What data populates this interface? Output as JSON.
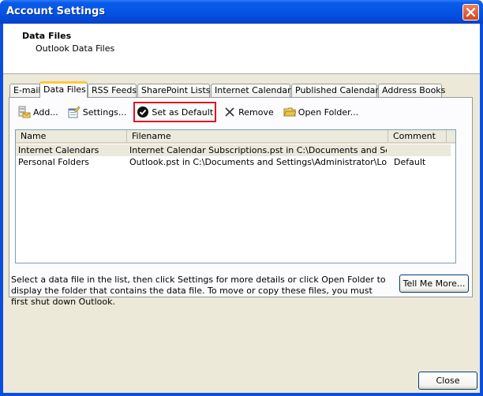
{
  "window": {
    "title": "Account Settings",
    "close_icon": "close-x-icon"
  },
  "header": {
    "title": "Data Files",
    "subtitle": "Outlook Data Files"
  },
  "tabs": [
    {
      "label": "E-mail",
      "active": false
    },
    {
      "label": "Data Files",
      "active": true
    },
    {
      "label": "RSS Feeds",
      "active": false
    },
    {
      "label": "SharePoint Lists",
      "active": false
    },
    {
      "label": "Internet Calendars",
      "active": false
    },
    {
      "label": "Published Calendars",
      "active": false
    },
    {
      "label": "Address Books",
      "active": false
    }
  ],
  "toolbar": {
    "add": {
      "label": "Add...",
      "icon": "add-data-file-icon"
    },
    "settings": {
      "label": "Settings...",
      "icon": "settings-icon"
    },
    "set_default": {
      "label": "Set as Default",
      "icon": "checkmark-circle-icon",
      "highlight_color": "#e0141e"
    },
    "remove": {
      "label": "Remove",
      "icon": "x-icon"
    },
    "open_folder": {
      "label": "Open Folder...",
      "icon": "folder-icon"
    }
  },
  "list": {
    "columns": [
      "Name",
      "Filename",
      "Comment"
    ],
    "rows": [
      {
        "name": "Internet Calendars",
        "filename": "Internet Calendar Subscriptions.pst in C:\\Documents and Settin...",
        "comment": "",
        "selected": true
      },
      {
        "name": "Personal Folders",
        "filename": "Outlook.pst in C:\\Documents and Settings\\Administrator\\Local S...",
        "comment": "Default",
        "selected": false
      }
    ]
  },
  "description": "Select a data file in the list, then click Settings for more details or click Open Folder to display the folder that contains the data file. To move or copy these files, you must first shut down Outlook.",
  "buttons": {
    "tell_me_more": "Tell Me More...",
    "close": "Close"
  }
}
